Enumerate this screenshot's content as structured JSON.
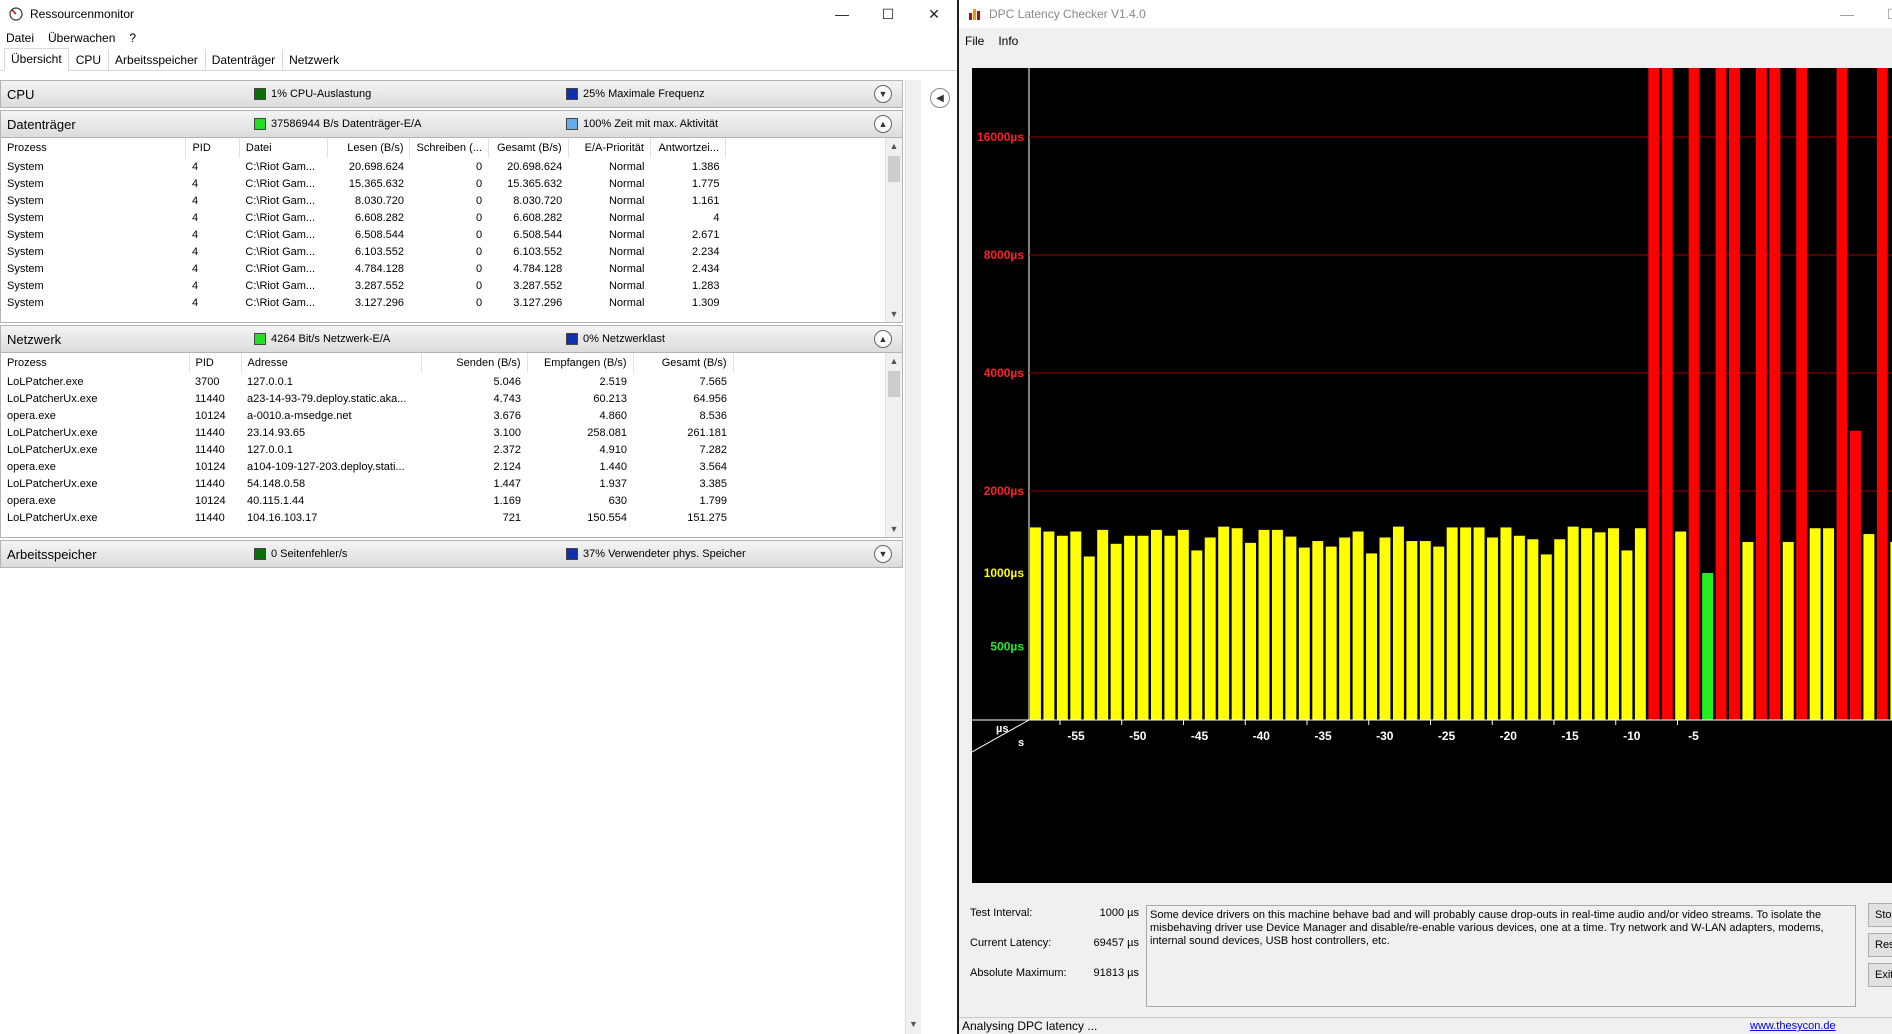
{
  "resmon": {
    "title": "Ressourcenmonitor",
    "menu": [
      "Datei",
      "Überwachen",
      "?"
    ],
    "tabs": [
      "Übersicht",
      "CPU",
      "Arbeitsspeicher",
      "Datenträger",
      "Netzwerk"
    ],
    "cpu": {
      "title": "CPU",
      "metric1": "1% CPU-Auslastung",
      "metric1_color": "#0a6e0a",
      "metric2": "25% Maximale Frequenz",
      "metric2_color": "#1030b0"
    },
    "disk": {
      "title": "Datenträger",
      "metric1": "37586944 B/s Datenträger-E/A",
      "metric1_color": "#22dd22",
      "metric2": "100% Zeit mit max. Aktivität",
      "metric2_color": "#66aaee",
      "columns": [
        "Prozess",
        "PID",
        "Datei",
        "Lesen (B/s)",
        "Schreiben (...",
        "Gesamt (B/s)",
        "E/A-Priorität",
        "Antwortzei..."
      ],
      "rows": [
        [
          "System",
          "4",
          "C:\\Riot Gam...",
          "20.698.624",
          "0",
          "20.698.624",
          "Normal",
          "1.386"
        ],
        [
          "System",
          "4",
          "C:\\Riot Gam...",
          "15.365.632",
          "0",
          "15.365.632",
          "Normal",
          "1.775"
        ],
        [
          "System",
          "4",
          "C:\\Riot Gam...",
          "8.030.720",
          "0",
          "8.030.720",
          "Normal",
          "1.161"
        ],
        [
          "System",
          "4",
          "C:\\Riot Gam...",
          "6.608.282",
          "0",
          "6.608.282",
          "Normal",
          "4"
        ],
        [
          "System",
          "4",
          "C:\\Riot Gam...",
          "6.508.544",
          "0",
          "6.508.544",
          "Normal",
          "2.671"
        ],
        [
          "System",
          "4",
          "C:\\Riot Gam...",
          "6.103.552",
          "0",
          "6.103.552",
          "Normal",
          "2.234"
        ],
        [
          "System",
          "4",
          "C:\\Riot Gam...",
          "4.784.128",
          "0",
          "4.784.128",
          "Normal",
          "2.434"
        ],
        [
          "System",
          "4",
          "C:\\Riot Gam...",
          "3.287.552",
          "0",
          "3.287.552",
          "Normal",
          "1.283"
        ],
        [
          "System",
          "4",
          "C:\\Riot Gam...",
          "3.127.296",
          "0",
          "3.127.296",
          "Normal",
          "1.309"
        ]
      ]
    },
    "network": {
      "title": "Netzwerk",
      "metric1": "4264 Bit/s Netzwerk-E/A",
      "metric1_color": "#22dd22",
      "metric2": "0% Netzwerklast",
      "metric2_color": "#1030b0",
      "columns": [
        "Prozess",
        "PID",
        "Adresse",
        "Senden (B/s)",
        "Empfangen (B/s)",
        "Gesamt (B/s)"
      ],
      "rows": [
        [
          "LoLPatcher.exe",
          "3700",
          "127.0.0.1",
          "5.046",
          "2.519",
          "7.565"
        ],
        [
          "LoLPatcherUx.exe",
          "11440",
          "a23-14-93-79.deploy.static.aka...",
          "4.743",
          "60.213",
          "64.956"
        ],
        [
          "opera.exe",
          "10124",
          "a-0010.a-msedge.net",
          "3.676",
          "4.860",
          "8.536"
        ],
        [
          "LoLPatcherUx.exe",
          "11440",
          "23.14.93.65",
          "3.100",
          "258.081",
          "261.181"
        ],
        [
          "LoLPatcherUx.exe",
          "11440",
          "127.0.0.1",
          "2.372",
          "4.910",
          "7.282"
        ],
        [
          "opera.exe",
          "10124",
          "a104-109-127-203.deploy.stati...",
          "2.124",
          "1.440",
          "3.564"
        ],
        [
          "LoLPatcherUx.exe",
          "11440",
          "54.148.0.58",
          "1.447",
          "1.937",
          "3.385"
        ],
        [
          "opera.exe",
          "10124",
          "40.115.1.44",
          "1.169",
          "630",
          "1.799"
        ],
        [
          "LoLPatcherUx.exe",
          "11440",
          "104.16.103.17",
          "721",
          "150.554",
          "151.275"
        ]
      ]
    },
    "memory": {
      "title": "Arbeitsspeicher",
      "metric1": "0 Seitenfehler/s",
      "metric1_color": "#0a6e0a",
      "metric2": "37% Verwendeter phys. Speicher",
      "metric2_color": "#1030b0"
    }
  },
  "dpc": {
    "title": "DPC Latency Checker V1.4.0",
    "menu": [
      "File",
      "Info"
    ],
    "info": {
      "test_interval_label": "Test Interval:",
      "test_interval_value": "1000 µs",
      "current_label": "Current Latency:",
      "current_value": "69457 µs",
      "absmax_label": "Absolute Maximum:",
      "absmax_value": "91813 µs",
      "message": "Some device drivers on this machine behave bad and will probably cause drop-outs in real-time audio and/or video streams. To isolate the misbehaving driver use Device Manager and disable/re-enable various devices, one at a time. Try network and W-LAN adapters, modems, internal sound devices, USB host controllers, etc.",
      "buttons": [
        "Stop",
        "Reset",
        "Exit"
      ]
    },
    "status": "Analysing DPC latency ...",
    "link": "www.thesycon.de"
  },
  "chart_data": {
    "type": "bar",
    "title": "",
    "xlabel": "s",
    "ylabel": "µs",
    "y_ticks": [
      {
        "label": "500µs",
        "value": 500,
        "color": "#22ee22"
      },
      {
        "label": "1000µs",
        "value": 1000,
        "color": "#ffff00"
      },
      {
        "label": "2000µs",
        "value": 2000,
        "color": "#ff2020"
      },
      {
        "label": "4000µs",
        "value": 4000,
        "color": "#ff2020"
      },
      {
        "label": "8000µs",
        "value": 8000,
        "color": "#ff2020"
      },
      {
        "label": "16000µs",
        "value": 16000,
        "color": "#ff2020"
      }
    ],
    "x_ticks": [
      -55,
      -50,
      -45,
      -40,
      -35,
      -30,
      -25,
      -20,
      -15,
      -10,
      -5
    ],
    "xlim": [
      -60,
      0
    ],
    "colors": {
      "green": "#22ee22",
      "yellow": "#ffff00",
      "red": "#ff0000",
      "grid": "#a00000"
    },
    "values": [
      1470,
      1420,
      1370,
      1420,
      1150,
      1440,
      1280,
      1370,
      1370,
      1440,
      1370,
      1440,
      1210,
      1350,
      1480,
      1460,
      1290,
      1440,
      1440,
      1360,
      1240,
      1310,
      1250,
      1350,
      1420,
      1180,
      1350,
      1480,
      1310,
      1310,
      1250,
      1470,
      1470,
      1470,
      1350,
      1470,
      1370,
      1330,
      1170,
      1330,
      1480,
      1460,
      1410,
      1460,
      1210,
      1460,
      1600000,
      1600000,
      1420,
      1600000,
      1000,
      1600000,
      1600000,
      1300,
      1600000,
      1600000,
      1300,
      1600000,
      1460,
      1460,
      1600000,
      2850,
      1390,
      1600000,
      1300
    ]
  }
}
